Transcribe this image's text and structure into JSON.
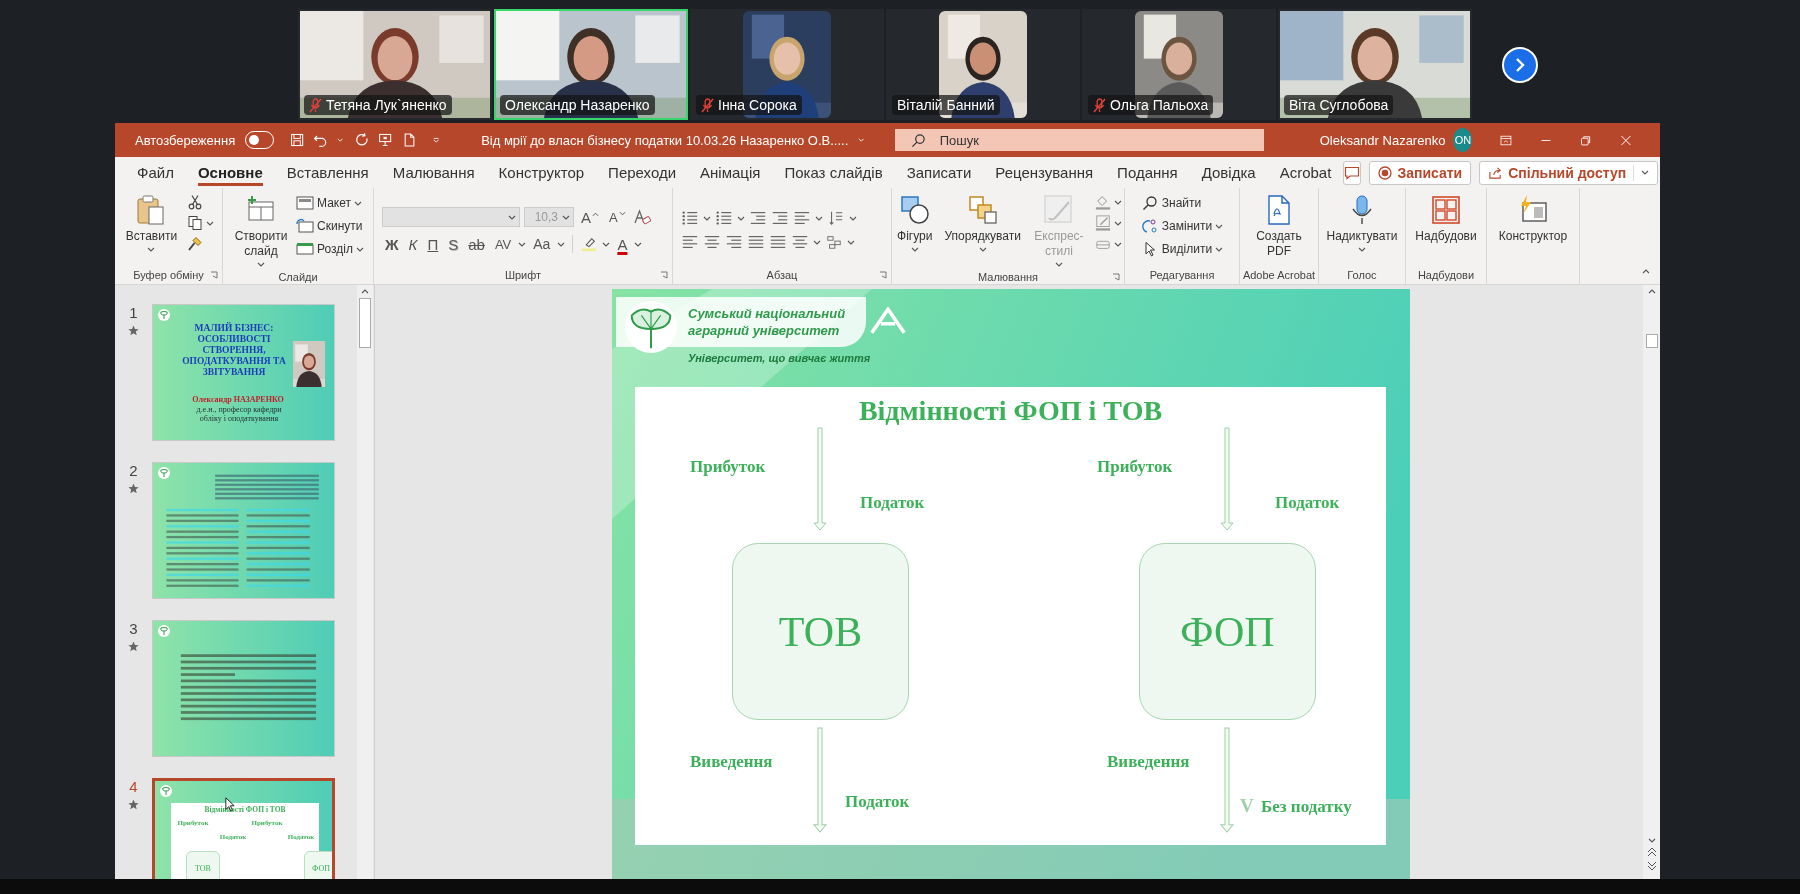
{
  "meeting": {
    "participants": [
      {
        "name": "Тетяна Лук`яненко",
        "muted": true,
        "speaking": false,
        "portrait": false
      },
      {
        "name": "Олександр Назаренко",
        "muted": false,
        "speaking": true,
        "portrait": false
      },
      {
        "name": "Інна Сорока",
        "muted": true,
        "speaking": false,
        "portrait": true
      },
      {
        "name": "Віталій Банний",
        "muted": false,
        "speaking": false,
        "portrait": true
      },
      {
        "name": "Ольга Пальоха",
        "muted": true,
        "speaking": false,
        "portrait": true
      },
      {
        "name": "Віта Суглобова",
        "muted": false,
        "speaking": false,
        "portrait": false
      }
    ]
  },
  "powerpoint": {
    "title_bar": {
      "autosave_label": "Автозбереження",
      "autosave_on": false,
      "document_title": "Від мрії до власн бізнесу податки 10.03.26 Назаренко О.В.....",
      "search_placeholder": "Пошук",
      "user_name": "Oleksandr Nazarenko",
      "user_initials": "ON"
    },
    "tabs": [
      {
        "label": "Файл",
        "selected": false
      },
      {
        "label": "Основне",
        "selected": true
      },
      {
        "label": "Вставлення",
        "selected": false
      },
      {
        "label": "Малювання",
        "selected": false
      },
      {
        "label": "Конструктор",
        "selected": false
      },
      {
        "label": "Переходи",
        "selected": false
      },
      {
        "label": "Анімація",
        "selected": false
      },
      {
        "label": "Показ слайдів",
        "selected": false
      },
      {
        "label": "Записати",
        "selected": false
      },
      {
        "label": "Рецензування",
        "selected": false
      },
      {
        "label": "Подання",
        "selected": false
      },
      {
        "label": "Довідка",
        "selected": false
      },
      {
        "label": "Acrobat",
        "selected": false
      }
    ],
    "tab_actions": {
      "record": "Записати",
      "share": "Спільний доступ"
    },
    "ribbon": {
      "clipboard": {
        "label": "Буфер обміну",
        "paste": "Вставити"
      },
      "slides": {
        "label": "Слайди",
        "new_slide": "Створити слайд",
        "layout": "Макет",
        "reset": "Скинути",
        "section": "Розділ"
      },
      "font": {
        "label": "Шрифт",
        "size": "10,3",
        "disabled": true,
        "grow": "A",
        "shrink": "A",
        "font_color_button": "A",
        "styles": [
          {
            "text": "Ж",
            "kind": "bold"
          },
          {
            "text": "К",
            "kind": "italic"
          },
          {
            "text": "П",
            "kind": "underline"
          },
          {
            "text": "S",
            "kind": "shadow"
          },
          {
            "text": "ab",
            "kind": "strike"
          },
          {
            "text": "AV",
            "kind": "spacing"
          },
          {
            "text": "Aa",
            "kind": "case"
          }
        ]
      },
      "paragraph": {
        "label": "Абзац"
      },
      "drawing": {
        "label": "Малювання",
        "shapes": "Фігури",
        "arrange": "Упорядкувати",
        "quick_styles": "Експрес-стилі",
        "quick_styles_disabled": true
      },
      "editing": {
        "label": "Редагування",
        "find": "Знайти",
        "replace": "Замінити",
        "select": "Виділити"
      },
      "acrobat": {
        "label": "Adobe Acrobat",
        "create_pdf": "Создать PDF"
      },
      "voice": {
        "label": "Голос",
        "dictate": "Надиктувати"
      },
      "addins": {
        "label": "Надбудови",
        "button": "Надбудови"
      },
      "designer": {
        "button": "Конструктор"
      }
    },
    "thumbnails": [
      {
        "number": "1",
        "selected": false,
        "kind": "title",
        "title": "МАЛИЙ БІЗНЕС: ОСОБЛИВОСТІ СТВОРЕННЯ, ОПОДАТКУВАННЯ ТА ЗВІТУВАННЯ",
        "author": "Олександр НАЗАРЕНКО",
        "position": "д.е.н., професор кафедри обліку і оподаткування"
      },
      {
        "number": "2",
        "selected": false,
        "kind": "table"
      },
      {
        "number": "3",
        "selected": false,
        "kind": "text"
      },
      {
        "number": "4",
        "selected": true,
        "kind": "diagram",
        "title": "Відмінності ФОП і ТОВ",
        "labels": [
          "Прибуток",
          "Податок",
          "Прибуток",
          "Податок"
        ],
        "boxes": [
          "ТОВ",
          "ФОП"
        ]
      }
    ],
    "slide": {
      "university": [
        "Сумський національний",
        "аграрний університет"
      ],
      "tagline": "Університет, що вивчає життя",
      "title": "Відмінності ФОП і ТОВ",
      "columns": [
        {
          "entity": "ТОВ",
          "income": "Прибуток",
          "income_tax": "Податок",
          "withdrawal": "Виведення",
          "withdrawal_tax": "Податок"
        },
        {
          "entity": "ФОП",
          "income": "Прибуток",
          "income_tax": "Податок",
          "withdrawal": "Виведення",
          "withdrawal_tax": "Без податку",
          "mark": "V"
        }
      ]
    }
  }
}
